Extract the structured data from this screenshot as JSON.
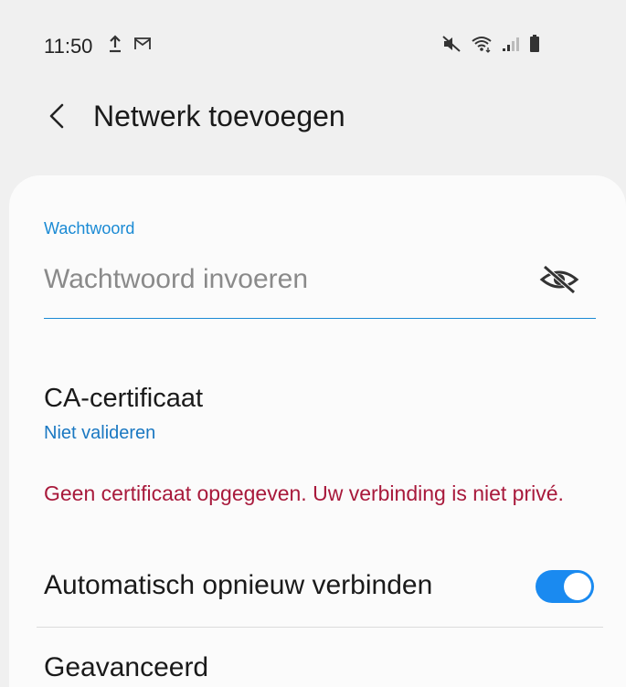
{
  "status_bar": {
    "time": "11:50",
    "left_icons": [
      "upload-icon",
      "gmail-icon"
    ],
    "right_icons": [
      "mute-icon",
      "wifi-icon",
      "signal-icon",
      "battery-icon"
    ]
  },
  "header": {
    "back_icon": "chevron-left-icon",
    "title": "Netwerk toevoegen"
  },
  "password": {
    "label": "Wachtwoord",
    "placeholder": "Wachtwoord invoeren",
    "value": "",
    "visibility_icon": "eye-off-icon"
  },
  "ca_certificate": {
    "title": "CA-certificaat",
    "value": "Niet valideren"
  },
  "warning": "Geen certificaat opgegeven. Uw verbinding is niet privé.",
  "auto_reconnect": {
    "label": "Automatisch opnieuw verbinden",
    "enabled": true
  },
  "advanced": {
    "label": "Geavanceerd"
  },
  "colors": {
    "accent": "#1a8ad4",
    "warning": "#a8193b",
    "toggle_on": "#1a8af0",
    "background": "#f0f0f0",
    "card": "#fbfbfb"
  }
}
